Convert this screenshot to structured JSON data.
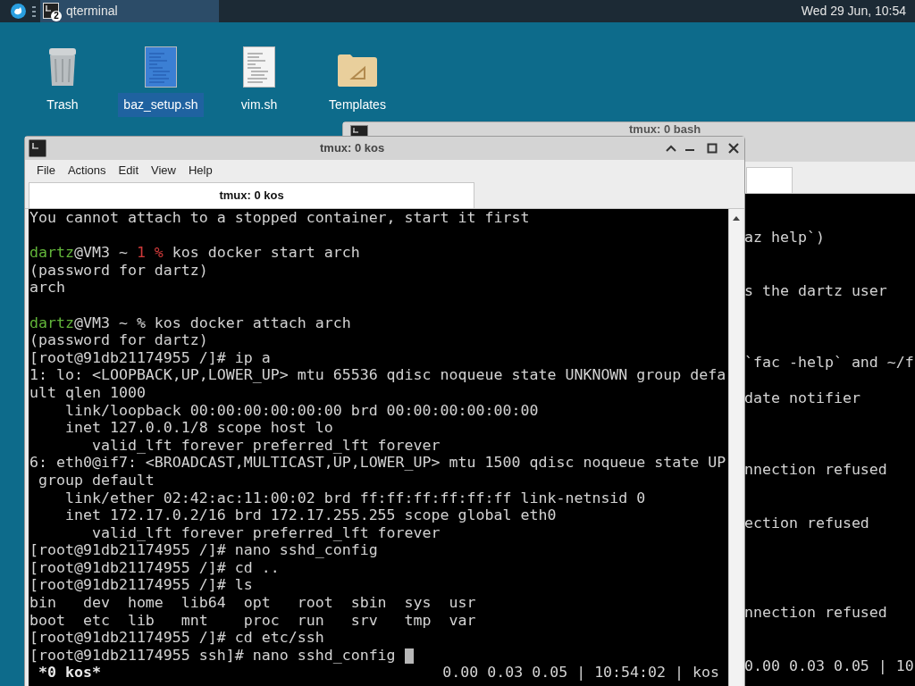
{
  "taskbar": {
    "task": {
      "label": "qterminal",
      "badge": "2",
      "selected": true
    },
    "clock": "Wed 29 Jun, 10:54"
  },
  "desktop_icons": [
    {
      "kind": "trash",
      "label": "Trash",
      "selected": false
    },
    {
      "kind": "document",
      "label": "baz_setup.sh",
      "selected": true
    },
    {
      "kind": "document",
      "label": "vim.sh",
      "selected": false
    },
    {
      "kind": "folder",
      "label": "Templates",
      "selected": false
    }
  ],
  "back_window": {
    "title": "tmux: 0 bash",
    "lines": [
      {
        "kind": "blank"
      },
      {
        "kind": "text",
        "text": "az help`)"
      },
      {
        "kind": "blank"
      },
      {
        "kind": "blank"
      },
      {
        "kind": "text",
        "text": "s the dartz user"
      },
      {
        "kind": "blank"
      },
      {
        "kind": "blank"
      },
      {
        "kind": "blank"
      },
      {
        "kind": "text",
        "text": "`fac -help` and ~/f"
      },
      {
        "kind": "blank"
      },
      {
        "kind": "text",
        "text": "date notifier"
      },
      {
        "kind": "blank"
      },
      {
        "kind": "blank"
      },
      {
        "kind": "blank"
      },
      {
        "kind": "text",
        "text": "nnection refused"
      },
      {
        "kind": "blank"
      },
      {
        "kind": "blank"
      },
      {
        "kind": "text",
        "text": "ection refused"
      },
      {
        "kind": "blank"
      },
      {
        "kind": "blank"
      },
      {
        "kind": "blank"
      },
      {
        "kind": "blank"
      },
      {
        "kind": "text",
        "text": "nnection refused"
      },
      {
        "kind": "blank"
      },
      {
        "kind": "blank"
      },
      {
        "kind": "text",
        "text": "0.00 0.03 0.05 | 10"
      }
    ]
  },
  "window": {
    "title": "tmux: 0 kos",
    "menu": [
      "File",
      "Actions",
      "Edit",
      "View",
      "Help"
    ],
    "tabs": [
      {
        "label": "tmux: 0 kos",
        "selected": true
      }
    ],
    "terminal": {
      "lines": [
        {
          "kind": "text",
          "text": "You cannot attach to a stopped container, start it first",
          "cursor": false
        },
        {
          "kind": "blank",
          "cursor": false
        },
        {
          "kind": "prompt",
          "segments": [
            {
              "kind": "user",
              "text": "dartz"
            },
            {
              "kind": "plain",
              "text": "@VM3 ~ "
            },
            {
              "kind": "error",
              "text": "1 %"
            },
            {
              "kind": "plain",
              "text": " kos docker start arch"
            }
          ],
          "cursor": false
        },
        {
          "kind": "text",
          "text": "(password for dartz)",
          "cursor": false
        },
        {
          "kind": "text",
          "text": "arch",
          "cursor": false
        },
        {
          "kind": "blank",
          "cursor": false
        },
        {
          "kind": "prompt",
          "segments": [
            {
              "kind": "user",
              "text": "dartz"
            },
            {
              "kind": "plain",
              "text": "@VM3 ~ % kos docker attach arch"
            }
          ],
          "cursor": false
        },
        {
          "kind": "text",
          "text": "(password for dartz)",
          "cursor": false
        },
        {
          "kind": "text",
          "text": "[root@91db21174955 /]# ip a",
          "cursor": false
        },
        {
          "kind": "text",
          "text": "1: lo: <LOOPBACK,UP,LOWER_UP> mtu 65536 qdisc noqueue state UNKNOWN group defa",
          "cursor": false
        },
        {
          "kind": "text",
          "text": "ult qlen 1000",
          "cursor": false
        },
        {
          "kind": "text",
          "text": "    link/loopback 00:00:00:00:00:00 brd 00:00:00:00:00:00",
          "cursor": false
        },
        {
          "kind": "text",
          "text": "    inet 127.0.0.1/8 scope host lo",
          "cursor": false
        },
        {
          "kind": "text",
          "text": "       valid_lft forever preferred_lft forever",
          "cursor": false
        },
        {
          "kind": "text",
          "text": "6: eth0@if7: <BROADCAST,MULTICAST,UP,LOWER_UP> mtu 1500 qdisc noqueue state UP",
          "cursor": false
        },
        {
          "kind": "text",
          "text": " group default",
          "cursor": false
        },
        {
          "kind": "text",
          "text": "    link/ether 02:42:ac:11:00:02 brd ff:ff:ff:ff:ff:ff link-netnsid 0",
          "cursor": false
        },
        {
          "kind": "text",
          "text": "    inet 172.17.0.2/16 brd 172.17.255.255 scope global eth0",
          "cursor": false
        },
        {
          "kind": "text",
          "text": "       valid_lft forever preferred_lft forever",
          "cursor": false
        },
        {
          "kind": "text",
          "text": "[root@91db21174955 /]# nano sshd_config",
          "cursor": false
        },
        {
          "kind": "text",
          "text": "[root@91db21174955 /]# cd ..",
          "cursor": false
        },
        {
          "kind": "text",
          "text": "[root@91db21174955 /]# ls",
          "cursor": false
        },
        {
          "kind": "text",
          "text": "bin   dev  home  lib64  opt   root  sbin  sys  usr",
          "cursor": false
        },
        {
          "kind": "text",
          "text": "boot  etc  lib   mnt    proc  run   srv   tmp  var",
          "cursor": false
        },
        {
          "kind": "text",
          "text": "[root@91db21174955 /]# cd etc/ssh",
          "cursor": false
        },
        {
          "kind": "text",
          "text": "[root@91db21174955 ssh]# nano sshd_config",
          "cursor": true
        }
      ],
      "status_left": "*0 kos*",
      "status_right": "0.00 0.03 0.05 | 10:54:02 | kos"
    }
  }
}
